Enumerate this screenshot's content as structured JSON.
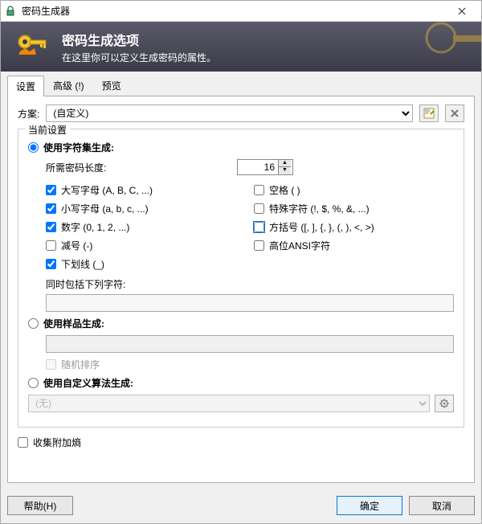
{
  "window": {
    "title": "密码生成器"
  },
  "header": {
    "title": "密码生成选项",
    "subtitle": "在这里你可以定义生成密码的属性。"
  },
  "tabs": [
    "设置",
    "高级 (!)",
    "预览"
  ],
  "scheme": {
    "label": "方案:",
    "selected": "(自定义)"
  },
  "fieldset_legend": "当前设置",
  "gen_charset": {
    "label": "使用字符集生成:"
  },
  "len": {
    "label": "所需密码长度:",
    "value": "16"
  },
  "checks": {
    "upper": "大写字母 (A, B, C, ...)",
    "space": "空格 ( )",
    "lower": "小写字母 (a, b, c, ...)",
    "special": "特殊字符 (!, $, %, &, ...)",
    "digits": "数字 (0, 1, 2, ...)",
    "brackets": "方括号 ([, ], {, }, (, ), <, >)",
    "minus": "减号 (-)",
    "highansi": "高位ANSI字符",
    "underscore": "下划线 (_)"
  },
  "also_include": "同时包括下列字符:",
  "gen_pattern": {
    "label": "使用样品生成:",
    "random_perm": "随机排序"
  },
  "gen_custom": {
    "label": "使用自定义算法生成:",
    "selected": "(无)"
  },
  "collect": "收集附加熵",
  "buttons": {
    "help": "帮助(H)",
    "ok": "确定",
    "cancel": "取消"
  }
}
